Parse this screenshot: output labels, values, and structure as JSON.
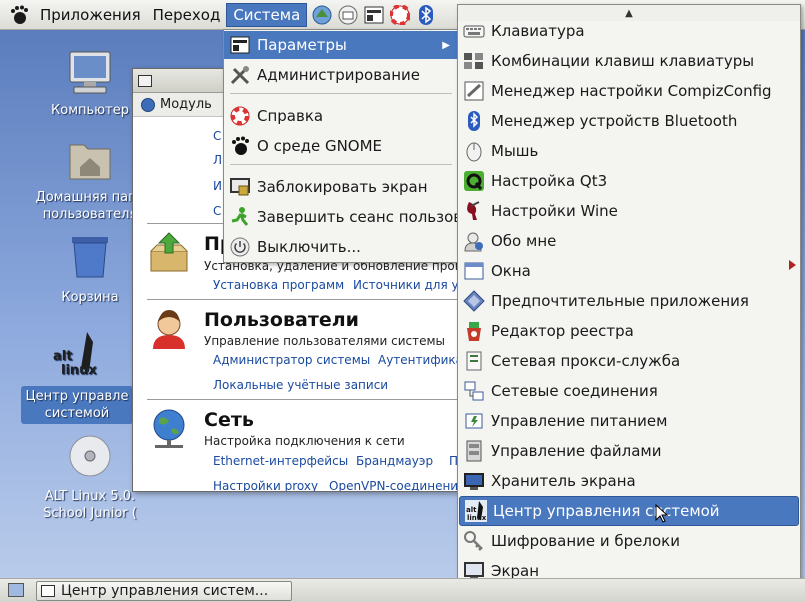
{
  "top_panel": {
    "applications_label": "Приложения",
    "places_label": "Переход",
    "system_label": "Система"
  },
  "desktop_icons": [
    {
      "label_lines": [
        "Компьютер"
      ]
    },
    {
      "label_lines": [
        "Домашняя папк",
        "пользователя"
      ]
    },
    {
      "label_lines": [
        "Корзина"
      ]
    },
    {
      "label_lines": [
        "Центр управле",
        "системой"
      ],
      "logo_text": "alt linux"
    },
    {
      "label_lines": [
        "ALT Linux 5.0.",
        "School Junior ("
      ]
    }
  ],
  "window": {
    "toolbar_label": "Модуль",
    "top_links": [
      "С",
      "Л",
      "И",
      "С"
    ],
    "sections": [
      {
        "title": "Пр",
        "description": "Установка, удаление и обновление програм",
        "links": [
          "Установка программ",
          "Источники для у"
        ]
      },
      {
        "title": "Пользователи",
        "description": "Управление пользователями системы",
        "links": [
          "Администратор системы",
          "Аутентификац",
          "Локальные учётные записи"
        ]
      },
      {
        "title": "Сеть",
        "description": "Настройка подключения к сети",
        "links": [
          "Ethernet-интерфейсы",
          "Брандмауэр",
          "П",
          "Настройки proxy",
          "OpenVPN-соединения"
        ]
      }
    ]
  },
  "system_menu": {
    "items": [
      {
        "label": "Параметры",
        "icon": "preferences-icon"
      },
      {
        "label": "Администрирование",
        "icon": "administration-icon"
      },
      {
        "label": "Справка",
        "icon": "help-icon"
      },
      {
        "label": "О среде GNOME",
        "icon": "gnome-foot-icon"
      },
      {
        "label": "Заблокировать экран",
        "icon": "lock-screen-icon"
      },
      {
        "label": "Завершить сеанс пользов",
        "icon": "logout-icon"
      },
      {
        "label": "Выключить...",
        "icon": "shutdown-icon"
      }
    ]
  },
  "preferences_menu": {
    "items": [
      {
        "label": "Клавиатура",
        "icon": "keyboard-icon"
      },
      {
        "label": "Комбинации клавиш клавиатуры",
        "icon": "keyboard-shortcuts-icon"
      },
      {
        "label": "Менеджер настройки CompizConfig",
        "icon": "compizconfig-icon"
      },
      {
        "label": "Менеджер устройств Bluetooth",
        "icon": "bluetooth-icon"
      },
      {
        "label": "Мышь",
        "icon": "mouse-icon"
      },
      {
        "label": "Настройка Qt3",
        "icon": "qt3-icon"
      },
      {
        "label": "Настройки Wine",
        "icon": "wine-icon"
      },
      {
        "label": "Обо мне",
        "icon": "about-me-icon"
      },
      {
        "label": "Окна",
        "icon": "windows-icon"
      },
      {
        "label": "Предпочтительные приложения",
        "icon": "preferred-apps-icon"
      },
      {
        "label": "Редактор реестра",
        "icon": "registry-editor-icon"
      },
      {
        "label": "Сетевая прокси-служба",
        "icon": "network-proxy-icon"
      },
      {
        "label": "Сетевые соединения",
        "icon": "network-connections-icon"
      },
      {
        "label": "Управление питанием",
        "icon": "power-management-icon"
      },
      {
        "label": "Управление файлами",
        "icon": "file-management-icon"
      },
      {
        "label": "Хранитель экрана",
        "icon": "screensaver-icon"
      },
      {
        "label": "Центр управления системой",
        "icon": "alt-linux-icon"
      },
      {
        "label": "Шифрование и брелоки",
        "icon": "encryption-keyring-icon"
      },
      {
        "label": "Экран",
        "icon": "display-icon"
      }
    ]
  },
  "taskbar": {
    "task_label": "Центр управления систем..."
  },
  "colors": {
    "selection": "#4a78bf",
    "link": "#1a4aa0",
    "desktop": "#6f8fc8"
  }
}
